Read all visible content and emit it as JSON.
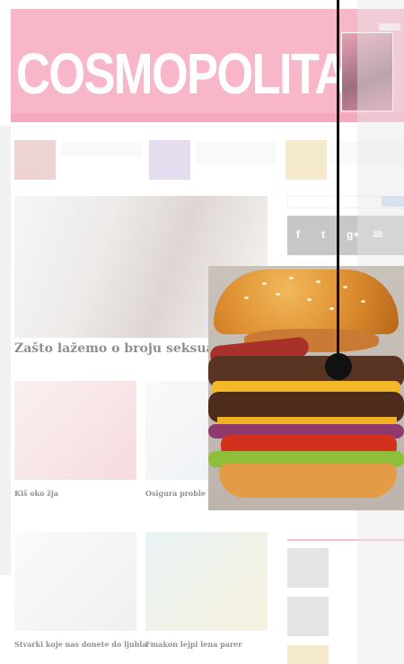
{
  "site": {
    "logo": "COSMOPOLITAN"
  },
  "nav": {
    "items": [
      "",
      "",
      "",
      "",
      "",
      "",
      "",
      ""
    ]
  },
  "featured": {
    "tag": "",
    "headline": "Zašto lažemo o broju seksualnih partne"
  },
  "cards": [
    {
      "title": "Kiš oko žja"
    },
    {
      "title": "Osigura proble"
    },
    {
      "title": "Stvarki koje nas donete do ljubla"
    },
    {
      "title": "Fmakon lejpi  lena parer"
    }
  ],
  "sidebar": {
    "title": ""
  },
  "colors": {
    "brand_pink": "#f7b7c9",
    "accent": "#e05585"
  }
}
